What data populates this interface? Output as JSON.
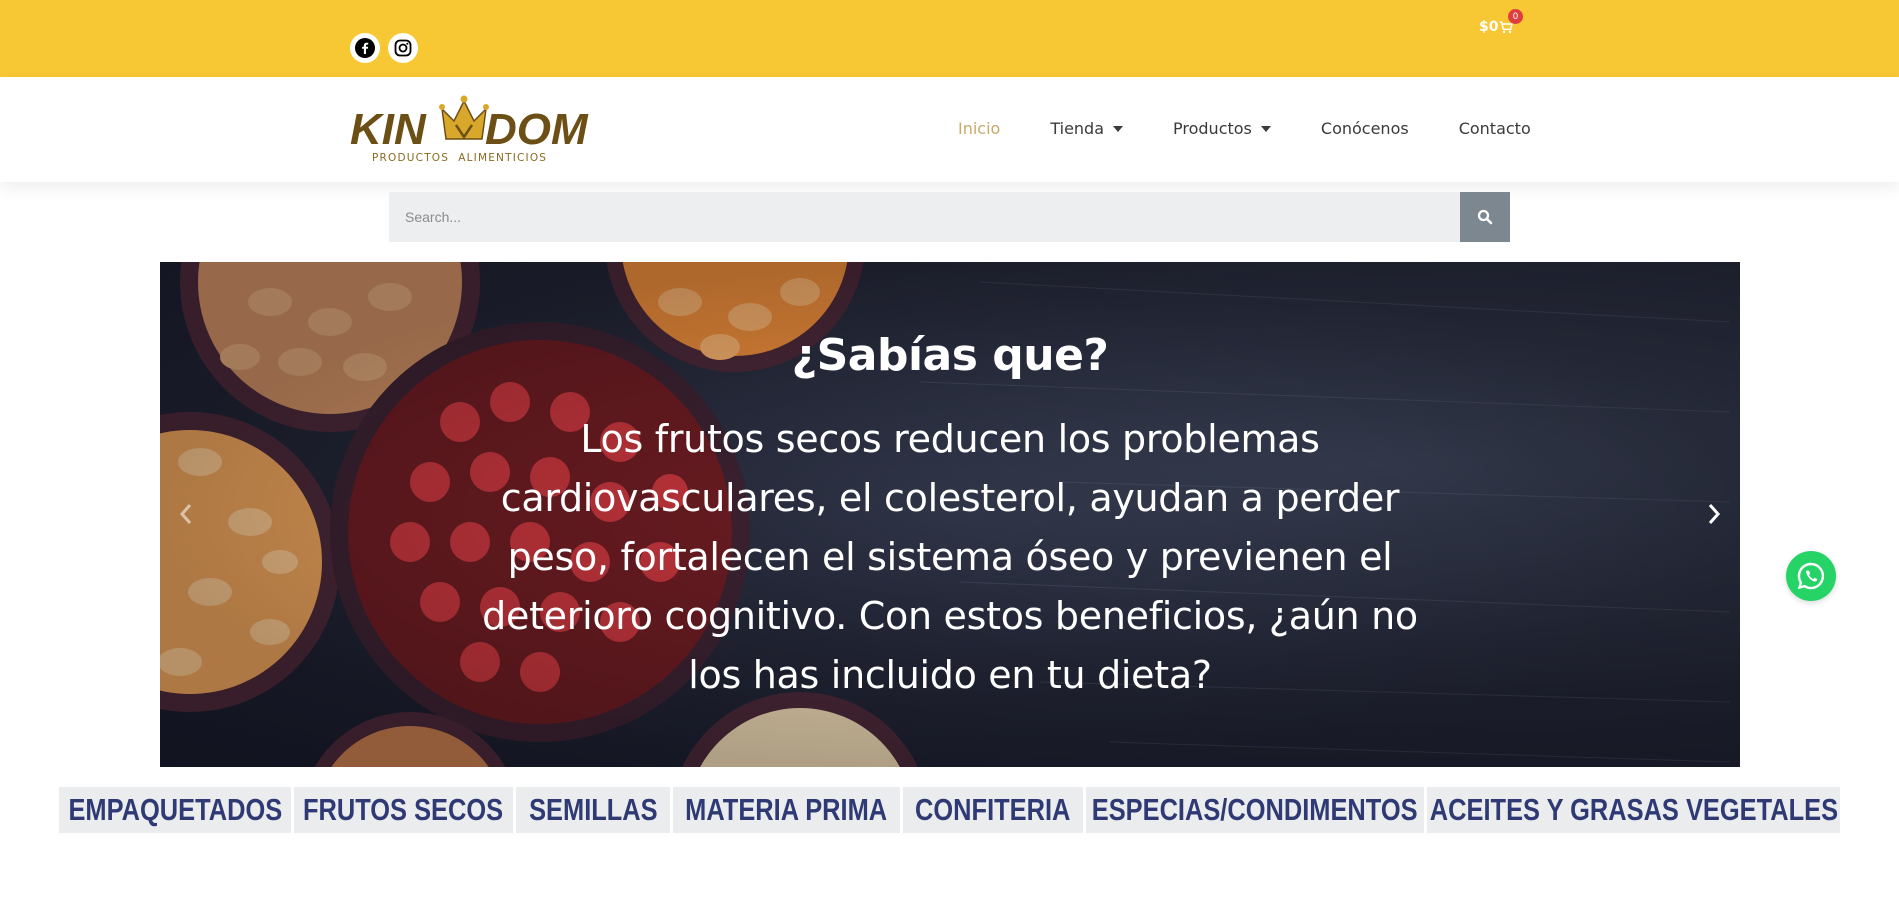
{
  "topbar": {
    "social": [
      {
        "name": "facebook-icon"
      },
      {
        "name": "instagram-icon"
      }
    ],
    "cart": {
      "amount": "$0",
      "count": "0"
    }
  },
  "header": {
    "logo": {
      "brand_left": "KIN",
      "brand_right": "DOM",
      "tagline": "PRODUCTOS  ALIMENTICIOS"
    },
    "nav": [
      {
        "label": "Inicio",
        "active": true,
        "dropdown": false
      },
      {
        "label": "Tienda",
        "active": false,
        "dropdown": true
      },
      {
        "label": "Productos",
        "active": false,
        "dropdown": true
      },
      {
        "label": "Conócenos",
        "active": false,
        "dropdown": false
      },
      {
        "label": "Contacto",
        "active": false,
        "dropdown": false
      }
    ]
  },
  "search": {
    "placeholder": "Search..."
  },
  "hero": {
    "title": "¿Sabías que?",
    "text": "Los frutos secos reducen los problemas cardiovasculares, el colesterol, ayudan a perder peso, fortalecen el sistema óseo y previenen el deterioro cognitivo. Con estos beneficios, ¿aún no los has incluido en tu dieta?"
  },
  "categories": [
    "EMPAQUETADOS",
    "FRUTOS SECOS",
    "SEMILLAS",
    "MATERIA PRIMA",
    "CONFITERIA",
    "ESPECIAS/CONDIMENTOS",
    "ACEITES Y GRASAS VEGETALES"
  ],
  "colors": {
    "topbar": "#f8c734",
    "nav_active": "#c9aa67",
    "category_text": "#2f3a74",
    "whatsapp": "#25d366",
    "logo_brown": "#6b4f14",
    "logo_gold": "#d9a82a"
  }
}
